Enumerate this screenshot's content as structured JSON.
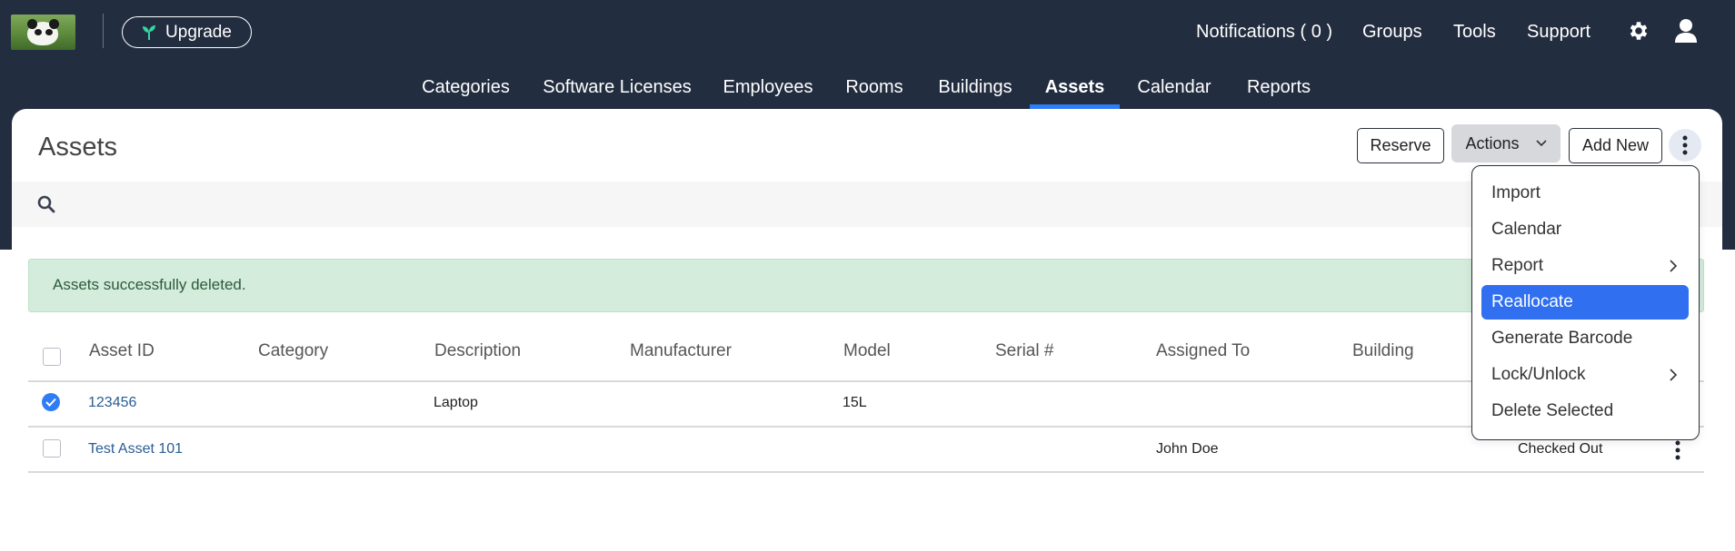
{
  "header": {
    "upgrade_label": "Upgrade",
    "nav": {
      "notifications": "Notifications ( 0 )",
      "groups": "Groups",
      "tools": "Tools",
      "support": "Support"
    }
  },
  "subnav": {
    "items": [
      "Categories",
      "Software Licenses",
      "Employees",
      "Rooms",
      "Buildings",
      "Assets",
      "Calendar",
      "Reports"
    ],
    "active": "Assets"
  },
  "page": {
    "title": "Assets",
    "reserve_label": "Reserve",
    "actions_label": "Actions",
    "add_new_label": "Add New"
  },
  "alert": {
    "text": "Assets successfully deleted."
  },
  "table": {
    "columns": [
      "Asset ID",
      "Category",
      "Description",
      "Manufacturer",
      "Model",
      "Serial #",
      "Assigned To",
      "Building"
    ],
    "rows": [
      {
        "checked": true,
        "asset_id": "123456",
        "description": "Laptop",
        "model": "15L",
        "assigned_to": "",
        "status": ""
      },
      {
        "checked": false,
        "asset_id": "Test Asset 101",
        "description": "",
        "model": "",
        "assigned_to": "John Doe",
        "status": "Checked Out"
      }
    ]
  },
  "dropdown": {
    "items": [
      "Import",
      "Calendar",
      "Report",
      "Reallocate",
      "Generate Barcode",
      "Lock/Unlock",
      "Delete Selected"
    ],
    "highlighted": "Reallocate"
  },
  "colors": {
    "topbar": "#232d40",
    "accent": "#2f7cf6",
    "alert_bg": "#d4ecdc",
    "link": "#2a5d94"
  },
  "icons": [
    "panda-logo",
    "sprout-icon",
    "gear-icon",
    "user-icon",
    "kebab-icon",
    "search-icon",
    "chevron-down-icon",
    "chevron-right-icon",
    "check-icon"
  ]
}
